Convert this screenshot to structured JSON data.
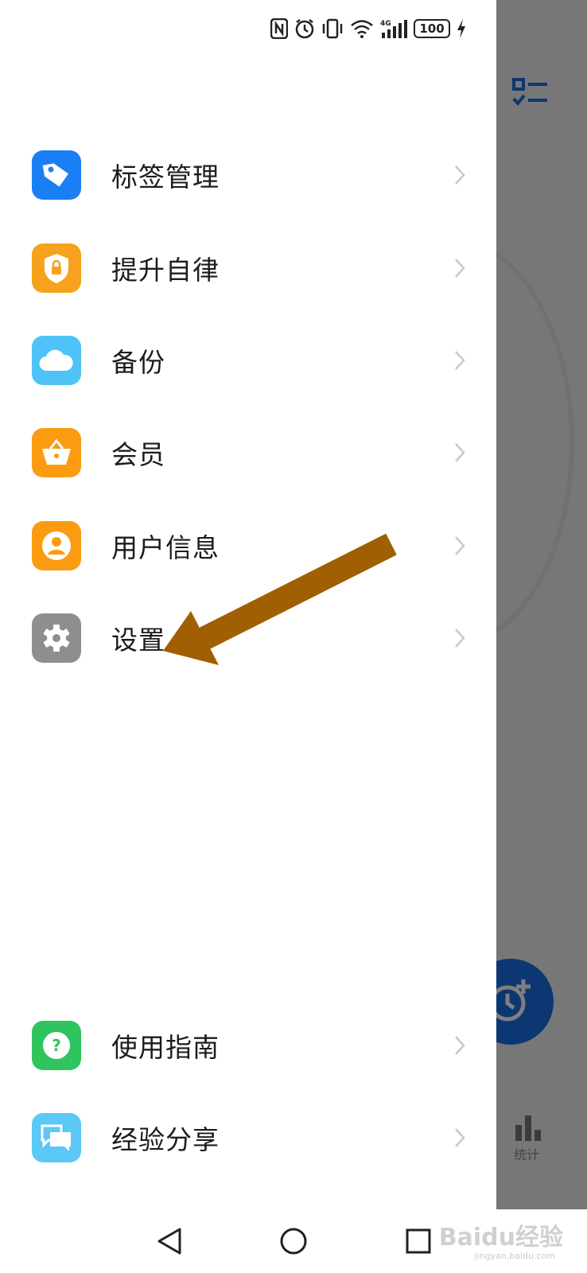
{
  "status_bar": {
    "icons": [
      "nfc-icon",
      "alarm-icon",
      "vibrate-icon",
      "wifi-icon",
      "signal-4g-icon",
      "charging-icon"
    ],
    "battery": "100",
    "network": "4G"
  },
  "background": {
    "stats_label": "统计"
  },
  "menu": {
    "items": [
      {
        "label": "标签管理",
        "icon": "tag-icon",
        "color": "#1a7ff5"
      },
      {
        "label": "提升自律",
        "icon": "shield-lock-icon",
        "color": "#f7a21c"
      },
      {
        "label": "备份",
        "icon": "cloud-icon",
        "color": "#4fc3f7"
      },
      {
        "label": "会员",
        "icon": "basket-icon",
        "color": "#fb9b12"
      },
      {
        "label": "用户信息",
        "icon": "user-icon",
        "color": "#fb9b12"
      },
      {
        "label": "设置",
        "icon": "gear-icon",
        "color": "#8e8e8e"
      }
    ],
    "bottom_items": [
      {
        "label": "使用指南",
        "icon": "help-icon",
        "color": "#2fc55e"
      },
      {
        "label": "经验分享",
        "icon": "chat-icon",
        "color": "#5bc8f5"
      }
    ]
  },
  "annotation": {
    "arrow_color": "#a05f00"
  },
  "watermark": {
    "text": "Baidu经验",
    "sub": "jingyan.baidu.com"
  }
}
